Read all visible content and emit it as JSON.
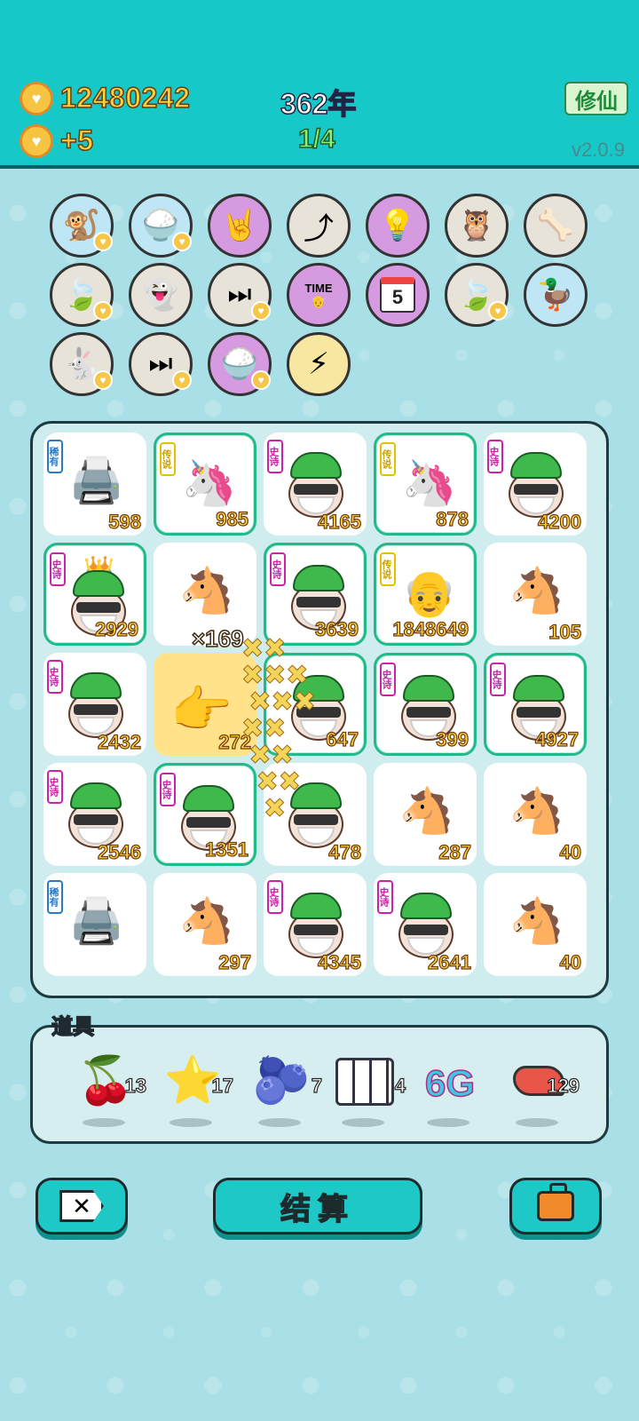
{
  "header": {
    "coins": "12480242",
    "income": "+5",
    "year": "362年",
    "stage": "1/4",
    "cultivate_button": "修仙",
    "version": "v2.0.9"
  },
  "buff_icons": [
    "monkey-icon",
    "rice-bowl-icon",
    "rock-hand-icon",
    "up-arrow-icon",
    "lightbulb-icon",
    "owl-coin-icon",
    "pet-bowl-icon",
    "leaf-icon",
    "ghost-icon",
    "skip-icon",
    "time-magazine-icon",
    "calendar-icon",
    "leaf-icon",
    "duck-pot-icon",
    "rabbit-icon",
    "skip-icon",
    "rice-bowl-icon",
    "lightning-icon"
  ],
  "calendar_day": "5",
  "magazine_title": "TIME",
  "grid": {
    "row1": [
      {
        "tag": "稀有",
        "count": "598",
        "type": "printer"
      },
      {
        "tag": "传说",
        "count": "985",
        "type": "unicorn"
      },
      {
        "tag": "史诗",
        "count": "4165",
        "type": "head"
      },
      {
        "tag": "传说",
        "count": "878",
        "type": "unicorn"
      },
      {
        "tag": "史诗",
        "count": "4200",
        "type": "head"
      }
    ],
    "row2": [
      {
        "tag": "史诗",
        "count": "2929",
        "type": "king"
      },
      {
        "tag": "",
        "count": "",
        "type": "horse"
      },
      {
        "tag": "史诗",
        "count": "3639",
        "type": "head"
      },
      {
        "tag": "传说",
        "count": "1848649",
        "type": "bald"
      },
      {
        "tag": "",
        "count": "105",
        "type": "horse"
      }
    ],
    "row3": [
      {
        "tag": "史诗",
        "count": "2432",
        "type": "head"
      },
      {
        "tag": "",
        "count": "272",
        "type": "hand"
      },
      {
        "tag": "",
        "count": "647",
        "type": "head"
      },
      {
        "tag": "史诗",
        "count": "399",
        "type": "head"
      },
      {
        "tag": "史诗",
        "count": "4927",
        "type": "head"
      }
    ],
    "row4": [
      {
        "tag": "史诗",
        "count": "2546",
        "type": "head"
      },
      {
        "tag": "史诗",
        "count": "1351",
        "type": "head"
      },
      {
        "tag": "",
        "count": "478",
        "type": "head"
      },
      {
        "tag": "",
        "count": "287",
        "type": "horse"
      },
      {
        "tag": "",
        "count": "40",
        "type": "horse"
      }
    ],
    "row5": [
      {
        "tag": "稀有",
        "count": "",
        "type": "printer"
      },
      {
        "tag": "",
        "count": "297",
        "type": "horse"
      },
      {
        "tag": "史诗",
        "count": "4345",
        "type": "head"
      },
      {
        "tag": "史诗",
        "count": "2641",
        "type": "head"
      },
      {
        "tag": "",
        "count": "40",
        "type": "horse"
      }
    ]
  },
  "multiplier": "×169",
  "items": {
    "title": "道具",
    "list": [
      {
        "name": "lychee",
        "qty": "13"
      },
      {
        "name": "star",
        "qty": "17"
      },
      {
        "name": "blueberry",
        "qty": "7"
      },
      {
        "name": "battery",
        "qty": "4"
      },
      {
        "name": "6g",
        "label": "6G",
        "qty": ""
      },
      {
        "name": "liver",
        "qty": "129"
      }
    ]
  },
  "buttons": {
    "settle": "结算"
  }
}
